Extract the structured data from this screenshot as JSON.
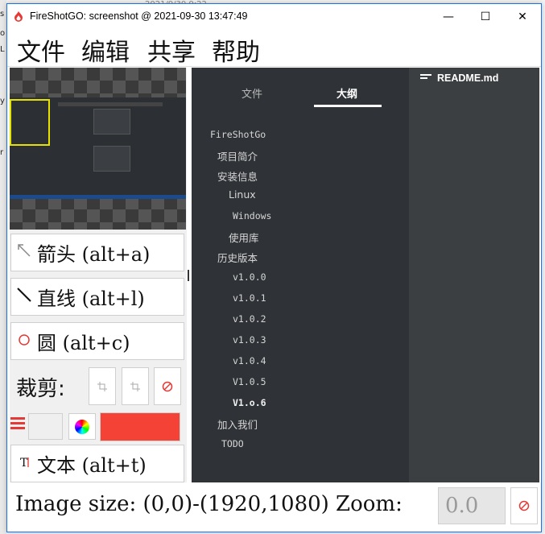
{
  "background": {
    "left_chars": [
      "s",
      "o",
      "L",
      "y",
      "r"
    ],
    "top_text": "2021/9/30 9:22"
  },
  "window": {
    "title": "FireShotGO: screenshot @ 2021-09-30 13:47:49",
    "app_icon": "flame-icon",
    "controls": {
      "minimize": "—",
      "maximize": "☐",
      "close": "✕"
    }
  },
  "menu": [
    "文件",
    "编辑",
    "共享",
    "帮助"
  ],
  "tools": {
    "arrow": {
      "icon": "arrow-icon",
      "label": "箭头 (alt+a)"
    },
    "line": {
      "icon": "line-icon",
      "label": "直线 (alt+l)"
    },
    "circle": {
      "icon": "circle-icon",
      "label": "圆 (alt+c)"
    },
    "crop_label": "裁剪:",
    "text": {
      "icon": "text-icon",
      "label": "文本 (alt+t)"
    }
  },
  "colors": {
    "accent": "#e53935",
    "swatch": "#f44336",
    "dark_pane": "#3c3f41",
    "sidebar": "#2f3236"
  },
  "outline": {
    "tabs": [
      "文件",
      "大纲"
    ],
    "active_tab": "大纲",
    "items": [
      "FireShotGo",
      "项目简介",
      "安装信息",
      "Linux",
      "Windows",
      "使用库",
      "历史版本",
      "v1.0.0",
      "v1.0.1",
      "v1.0.2",
      "v1.0.3",
      "v1.0.4",
      "V1.0.5",
      "V1.o.6",
      "加入我们",
      "TODO"
    ]
  },
  "editor": {
    "file_name": "README.md"
  },
  "status": {
    "image_size": "Image size: (0,0)-(1920,1080) Zoom:",
    "zoom_value": "0.0"
  }
}
